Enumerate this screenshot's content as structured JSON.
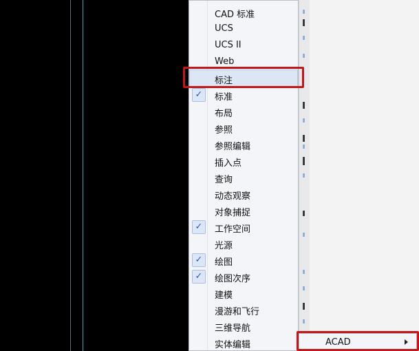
{
  "toolbars_menu": {
    "items": [
      {
        "label": "CAD 标准",
        "checked": false
      },
      {
        "label": "UCS",
        "checked": false
      },
      {
        "label": "UCS II",
        "checked": false
      },
      {
        "label": "Web",
        "checked": false
      },
      {
        "label": "标注",
        "checked": false,
        "highlighted": true
      },
      {
        "label": "标准",
        "checked": true
      },
      {
        "label": "布局",
        "checked": false
      },
      {
        "label": "参照",
        "checked": false
      },
      {
        "label": "参照编辑",
        "checked": false
      },
      {
        "label": "插入点",
        "checked": false
      },
      {
        "label": "查询",
        "checked": false
      },
      {
        "label": "动态观察",
        "checked": false
      },
      {
        "label": "对象捕捉",
        "checked": false
      },
      {
        "label": "工作空间",
        "checked": true
      },
      {
        "label": "光源",
        "checked": false
      },
      {
        "label": "绘图",
        "checked": true
      },
      {
        "label": "绘图次序",
        "checked": true
      },
      {
        "label": "建模",
        "checked": false
      },
      {
        "label": "漫游和飞行",
        "checked": false
      },
      {
        "label": "三维导航",
        "checked": false
      },
      {
        "label": "实体编辑",
        "checked": false
      }
    ]
  },
  "submenu": {
    "label": "ACAD"
  },
  "colors": {
    "highlight_border": "#c01818",
    "check_color": "#2b59c3",
    "canvas": "#000000",
    "canvas_line": "#49a3b8"
  }
}
